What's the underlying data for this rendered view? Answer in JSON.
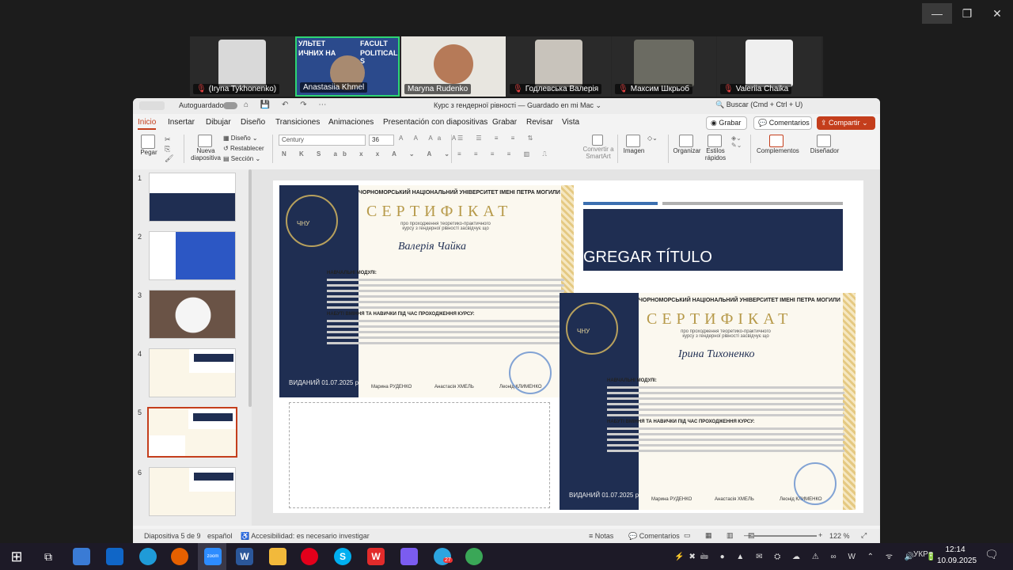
{
  "window_controls": {
    "minimize": "—",
    "maximize": "❐",
    "close": "✕"
  },
  "participants": [
    {
      "name": "(Iryna Tykhonenko)",
      "muted": true,
      "color": "#d9d9d9"
    },
    {
      "name": "Anastasiia Khmel",
      "muted": false,
      "active": true,
      "color": "#2b4a8c",
      "bg_text_1": "УЛЬТЕТ",
      "bg_text_2": "FACULT",
      "bg_text_3": "ИЧНИХ НА",
      "bg_text_4": "POLITICAL S"
    },
    {
      "name": "Maryna Rudenko",
      "muted": false,
      "color": "#e8e6e0"
    },
    {
      "name": "Годлевська Валерія",
      "muted": true,
      "color": "#c8c3bb"
    },
    {
      "name": "Максим Шкрьоб",
      "muted": true,
      "color": "#6b6b62"
    },
    {
      "name": "Valeriia Chaika",
      "muted": true,
      "color": "#efefef"
    }
  ],
  "ppt": {
    "autosave": "Autoguardado",
    "doc_title": "Курс з гендерної рівності — Guardado en mi Mac ⌄",
    "search": "Buscar (Cmd + Ctrl + U)",
    "menu": [
      "Inicio",
      "Insertar",
      "Dibujar",
      "Diseño",
      "Transiciones",
      "Animaciones",
      "Presentación con diapositivas",
      "Grabar",
      "Revisar",
      "Vista"
    ],
    "record_btn": "Grabar",
    "comments_btn": "Comentarios",
    "share_btn": "Compartir",
    "ribbon": {
      "paste": "Pegar",
      "new_slide": "Nueva diapositiva",
      "design": "Diseño",
      "reset": "Restablecer",
      "section": "Sección",
      "font": "Century",
      "size": "36",
      "convert": "Convertir a SmartArt",
      "image": "Imagen",
      "arrange": "Organizar",
      "styles": "Estilos rápidos",
      "addins": "Complementos",
      "designer": "Diseñador"
    },
    "thumbnails": [
      "1",
      "2",
      "3",
      "4",
      "5",
      "6"
    ],
    "slide": {
      "add_title": "GREGAR TÍTULO",
      "cert1": {
        "university": "ЧОРНОМОРСЬКИЙ НАЦІОНАЛЬНИЙ УНІВЕРСИТЕТ ІМЕНІ ПЕТРА МОГИЛИ",
        "title": "СЕРТИФІКАТ",
        "subtitle": "про проходження теоретико-практичного курсу з гендерної рівності засвідчує що",
        "name": "Валерія Чайка",
        "modules_heading": "НАВЧАЛЬНІ МОДУЛІ:",
        "skills_heading": "НАБУТІ ВМІННЯ ТА НАВИЧКИ ПІД ЧАС ПРОХОДЖЕННЯ КУРСУ:",
        "issued": "ВИДАНИЙ 01.07.2025 р.",
        "sign1": "Марина РУДЕНКО",
        "sign2": "Анастасія ХМЕЛЬ",
        "sign3": "Леонід КЛИМЕНКО",
        "logo": "ЧНУ"
      },
      "cert2": {
        "university": "ЧОРНОМОРСЬКИЙ НАЦІОНАЛЬНИЙ УНІВЕРСИТЕТ ІМЕНІ ПЕТРА МОГИЛИ",
        "title": "СЕРТИФІКАТ",
        "subtitle": "про проходження теоретико-практичного курсу з гендерної рівності засвідчує що",
        "name": "Ірина Тихоненко",
        "modules_heading": "НАВЧАЛЬНІ МОДУЛІ:",
        "skills_heading": "НАБУТІ ВМІННЯ ТА НАВИЧКИ ПІД ЧАС ПРОХОДЖЕННЯ КУРСУ:",
        "issued": "ВИДАНИЙ 01.07.2025 р.",
        "sign1": "Марина РУДЕНКО",
        "sign2": "Анастасія ХМЕЛЬ",
        "sign3": "Леонід КЛИМЕНКО",
        "logo": "ЧНУ"
      }
    },
    "status": {
      "slide_of": "Diapositiva 5 de 9",
      "language": "español",
      "accessibility": "Accesibilidad: es necesario investigar",
      "notes": "Notas",
      "comments": "Comentarios",
      "zoom": "122 %"
    }
  },
  "taskbar": {
    "apps": [
      {
        "name": "windows-start-icon",
        "color": "#2b8de0"
      },
      {
        "name": "task-view-icon",
        "color": "#555"
      },
      {
        "name": "store-icon",
        "color": "#3a7bd5"
      },
      {
        "name": "outlook-icon",
        "color": "#1066c7"
      },
      {
        "name": "edge-icon",
        "color": "#1f9bd8"
      },
      {
        "name": "firefox-icon",
        "color": "#e66000"
      },
      {
        "name": "zoom-icon",
        "color": "#2d8cff"
      },
      {
        "name": "word-icon",
        "color": "#2b579a"
      },
      {
        "name": "explorer-icon",
        "color": "#f2b93b"
      },
      {
        "name": "opera-icon",
        "color": "#e3001b"
      },
      {
        "name": "skype-icon",
        "color": "#00aff0"
      },
      {
        "name": "wps-icon",
        "color": "#e22b2b"
      },
      {
        "name": "copilot-icon",
        "color": "#7b5cf0"
      },
      {
        "name": "telegram-icon",
        "color": "#2ca5e0"
      },
      {
        "name": "chrome-icon",
        "color": "#3aa757"
      }
    ],
    "zoom_label": "zoom",
    "telegram_badge": "27",
    "language": "УКР",
    "time": "12:14",
    "date": "10.09.2025"
  }
}
